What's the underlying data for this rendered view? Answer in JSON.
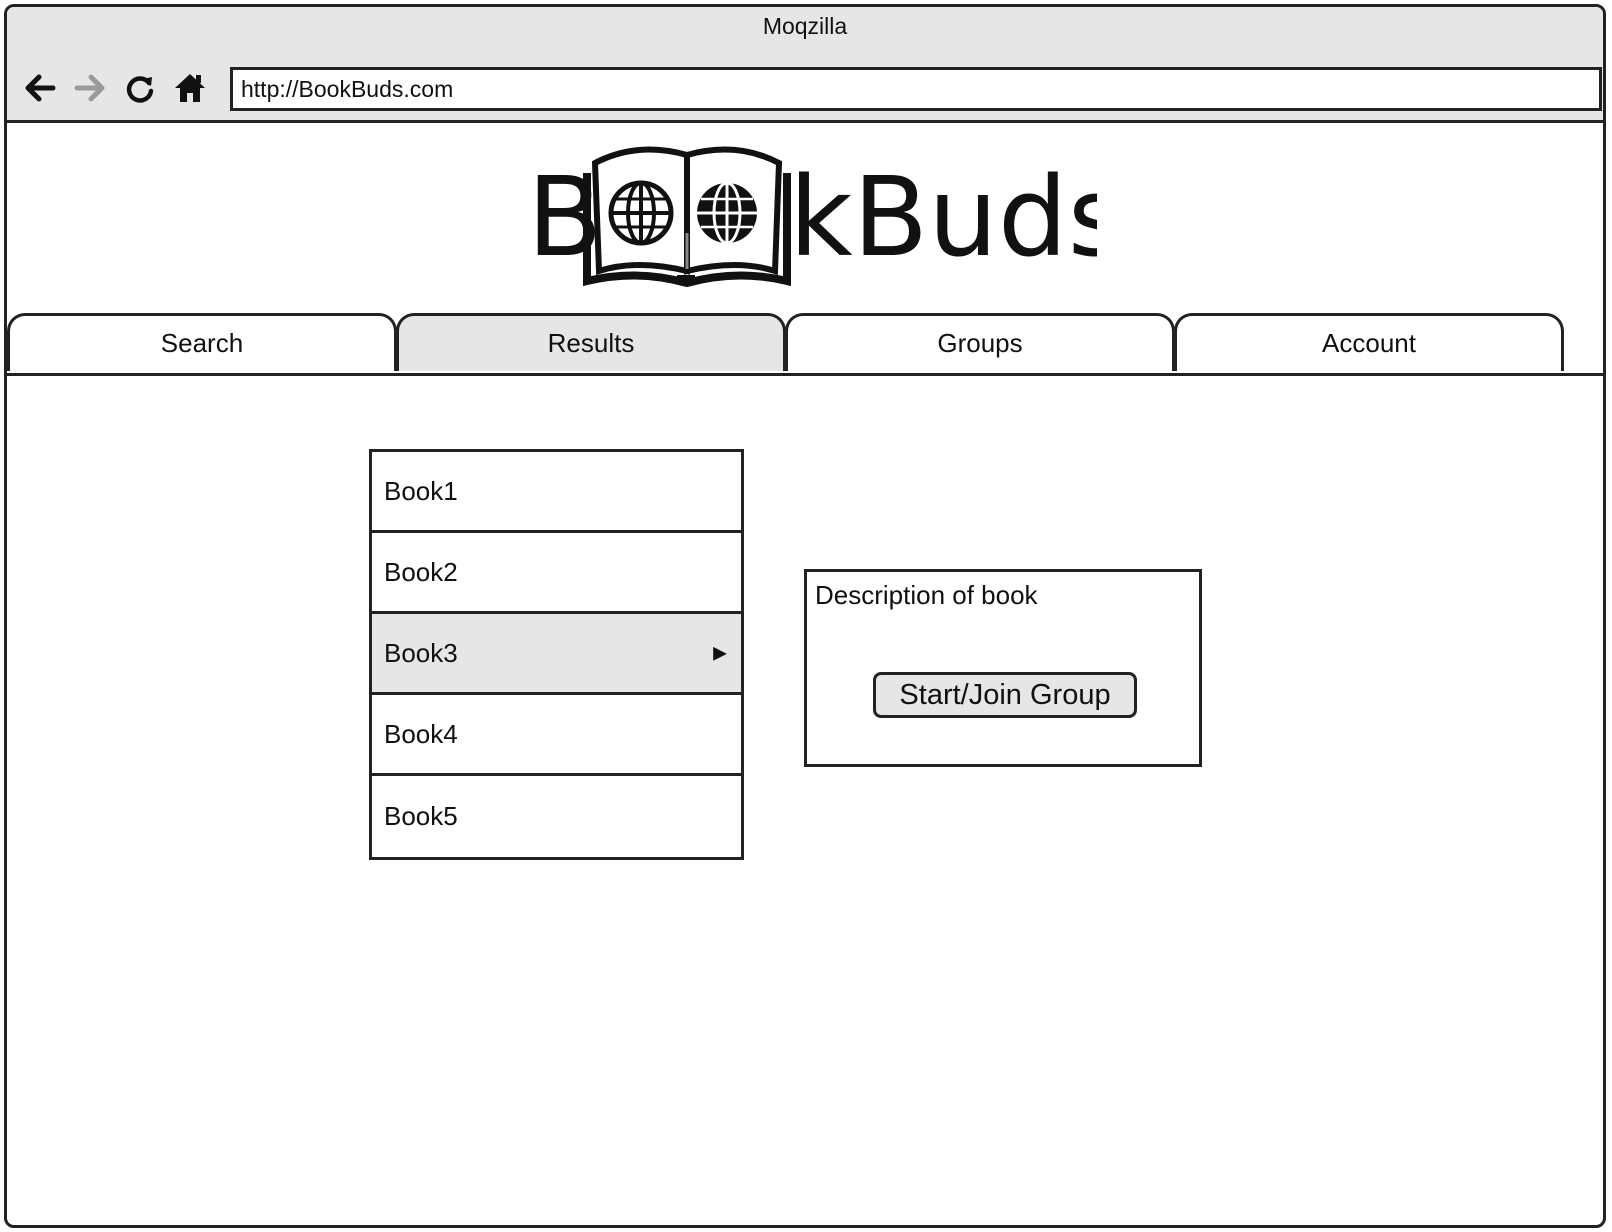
{
  "window": {
    "title": "Moqzilla",
    "url": "http://BookBuds.com"
  },
  "toolbar": {
    "back_icon": "arrow-left-icon",
    "forward_icon": "arrow-right-icon",
    "reload_icon": "reload-icon",
    "home_icon": "home-icon"
  },
  "logo": {
    "text_prefix": "B",
    "text_suffix": "kBuds",
    "icon": "open-book-with-globes-icon"
  },
  "tabs": [
    {
      "label": "Search",
      "active": false
    },
    {
      "label": "Results",
      "active": true
    },
    {
      "label": "Groups",
      "active": false
    },
    {
      "label": "Account",
      "active": false
    }
  ],
  "results": {
    "books": [
      "Book1",
      "Book2",
      "Book3",
      "Book4",
      "Book5"
    ],
    "selected_index": 2
  },
  "description": {
    "label": "Description of book",
    "button_label": "Start/Join Group"
  },
  "colors": {
    "chrome_bg": "#e6e6e6",
    "selected_bg": "#e6e6e6",
    "border": "#222222",
    "inactive_icon": "#9a9a9a"
  }
}
